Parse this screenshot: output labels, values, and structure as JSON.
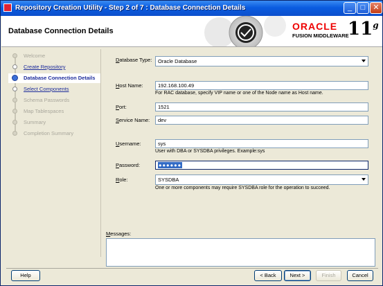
{
  "window": {
    "title": "Repository Creation Utility - Step 2 of 7 : Database Connection Details",
    "controls": [
      "minimize",
      "maximize",
      "close"
    ]
  },
  "header": {
    "heading": "Database Connection Details",
    "brand": "ORACLE",
    "brand_sub": "FUSION MIDDLEWARE",
    "version": "11",
    "version_sup": "g"
  },
  "nav": {
    "items": [
      {
        "label": "Welcome",
        "state": "disabled"
      },
      {
        "label": "Create Repository",
        "state": "done"
      },
      {
        "label": "Database Connection Details",
        "state": "current"
      },
      {
        "label": "Select Components",
        "state": "done"
      },
      {
        "label": "Schema Passwords",
        "state": "disabled"
      },
      {
        "label": "Map Tablespaces",
        "state": "disabled"
      },
      {
        "label": "Summary",
        "state": "disabled"
      },
      {
        "label": "Completion Summary",
        "state": "disabled"
      }
    ]
  },
  "form": {
    "db_type_label_pre": "D",
    "db_type_label_rest": "atabase Type:",
    "db_type_value": "Oracle Database",
    "host_label_pre": "H",
    "host_label_rest": "ost Name:",
    "host_value": "192.168.100.49",
    "host_hint": "For RAC database, specify VIP name or one of the Node name as Host name.",
    "port_label_pre": "P",
    "port_label_rest": "ort:",
    "port_value": "1521",
    "service_label_pre": "S",
    "service_label_rest": "ervice Name:",
    "service_value": "dev",
    "user_label_pre": "U",
    "user_label_rest": "sername:",
    "user_value": "sys",
    "user_hint": "User with DBA or SYSDBA privileges. Example:sys",
    "password_label_pre": "P",
    "password_label_rest": "assword:",
    "password_mask": "●●●●●●",
    "role_label_pre": "R",
    "role_label_rest": "ole:",
    "role_value": "SYSDBA",
    "role_hint": "One or more components may require SYSDBA role for the operation to succeed."
  },
  "messages": {
    "label_pre": "M",
    "label_rest": "essages:"
  },
  "buttons": {
    "help": "Help",
    "back": "< Back",
    "next": "Next >",
    "finish": "Finish",
    "cancel": "Cancel"
  }
}
